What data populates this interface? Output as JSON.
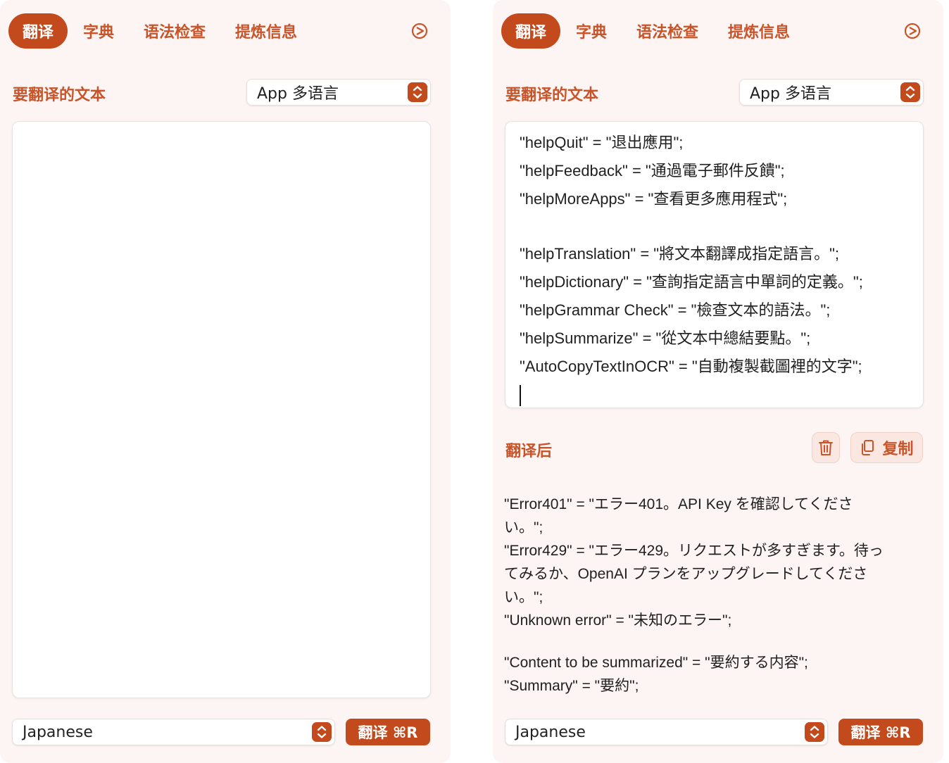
{
  "tabs": [
    {
      "label": "翻译",
      "active": true
    },
    {
      "label": "字典",
      "active": false
    },
    {
      "label": "语法检查",
      "active": false
    },
    {
      "label": "提炼信息",
      "active": false
    }
  ],
  "source_section_title": "要翻译的文本",
  "mode_select_value": "App 多语言",
  "result_section_title": "翻译后",
  "copy_label": "复制",
  "target_language": "Japanese",
  "translate_button_label": "翻译 ⌘R",
  "left_panel": {
    "source_text": ""
  },
  "right_panel": {
    "source_lines": [
      "\"helpQuit\" = \"退出應用\";",
      "\"helpFeedback\" = \"通過電子郵件反饋\";",
      "\"helpMoreApps\" = \"查看更多應用程式\";",
      "",
      "\"helpTranslation\" = \"將文本翻譯成指定語言。\";",
      "\"helpDictionary\" = \"查詢指定語言中單詞的定義。\";",
      "\"helpGrammar Check\" = \"檢查文本的語法。\";",
      "\"helpSummarize\" = \"從文本中總結要點。\";",
      "\"AutoCopyTextInOCR\" = \"自動複製截圖裡的文字\";"
    ],
    "result_lines": [
      "\"Error401\" = \"エラー401。API Key を確認してくださ",
      "い。\";",
      "\"Error429\" = \"エラー429。リクエストが多すぎます。待っ",
      "てみるか、OpenAI プランをアップグレードしてくださ",
      "い。\";",
      "\"Unknown error\" = \"未知のエラー\";",
      "",
      "\"Content to be summarized\" = \"要約する内容\";",
      "\"Summary\" = \"要約\";"
    ]
  },
  "colors": {
    "accent": "#c34a1c",
    "accent_text": "#c8542a",
    "panel_bg": "#fdf5f3"
  }
}
